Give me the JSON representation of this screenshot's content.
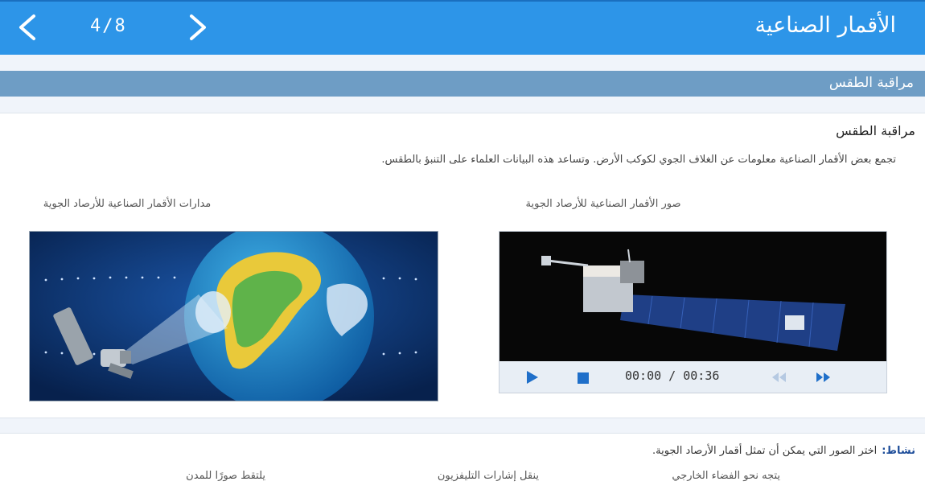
{
  "header": {
    "title": "الأقمار الصناعية",
    "page_counter": "4/8",
    "prev_icon": "chevron-left-icon",
    "next_icon": "chevron-right-icon",
    "background_color": "#2d95e8"
  },
  "section": {
    "label": "مراقبة الطقس",
    "color": "#6e9dc5"
  },
  "content": {
    "heading": "مراقبة الطقس",
    "description": "تجمع بعض الأقمار الصناعية معلومات عن الغلاف الجوي لكوكب الأرض. وتساعد هذه البيانات العلماء على التنبؤ بالطقس.",
    "media": [
      {
        "caption": "صور الأقمار الصناعية للأرصاد الجوية"
      },
      {
        "caption": "مدارات الأقمار الصناعية للأرصاد الجوية"
      }
    ],
    "video": {
      "time": "00:00 / 00:36",
      "play_icon": "play-icon",
      "stop_icon": "stop-icon",
      "rewind_icon": "rewind-icon",
      "forward_icon": "fast-forward-icon",
      "accent_color": "#1f6fc9"
    }
  },
  "activity": {
    "label": "نشاط:",
    "prompt": "اختر الصور التي يمكن أن تمثل أقمار الأرصاد الجوية.",
    "options": [
      "يتجه نحو الفضاء الخارجي",
      "ينقل إشارات التليفزيون",
      "يلتقط صورًا للمدن"
    ]
  }
}
